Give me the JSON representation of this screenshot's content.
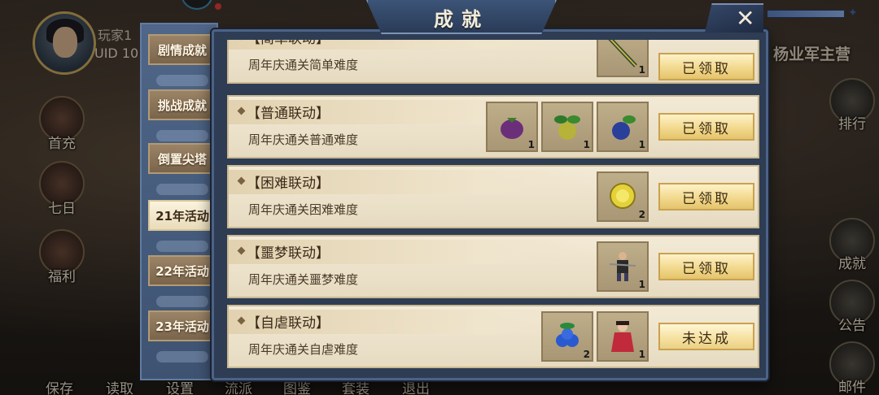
{
  "player": {
    "name": "玩家1",
    "uid": "UID 10"
  },
  "camp_title": "杨业军主营",
  "left_menu": [
    {
      "label": "首充"
    },
    {
      "label": "七日"
    },
    {
      "label": "福利"
    }
  ],
  "right_menu": [
    {
      "label": "排行"
    },
    {
      "label": "成就"
    },
    {
      "label": "公告"
    },
    {
      "label": "邮件"
    }
  ],
  "bottom_menu": [
    {
      "label": "保存"
    },
    {
      "label": "读取"
    },
    {
      "label": "设置"
    },
    {
      "label": "流派"
    },
    {
      "label": "图鉴"
    },
    {
      "label": "套装"
    },
    {
      "label": "退出"
    }
  ],
  "dialog": {
    "title": "成就",
    "close_icon": "close-x"
  },
  "tabs": [
    {
      "label": "剧情成就",
      "active": false
    },
    {
      "label": "挑战成就",
      "active": false
    },
    {
      "label": "倒置尖塔",
      "active": false
    },
    {
      "label": "21年活动",
      "active": true
    },
    {
      "label": "22年活动",
      "active": false
    },
    {
      "label": "23年活动",
      "active": false
    }
  ],
  "achievements": [
    {
      "title": "【简单联动】",
      "desc": "周年庆通关简单难度",
      "rewards": [
        {
          "icon": "spear-icon",
          "count": "1"
        }
      ],
      "button": "已领取"
    },
    {
      "title": "【普通联动】",
      "desc": "周年庆通关普通难度",
      "rewards": [
        {
          "icon": "purple-fruit-icon",
          "count": "1"
        },
        {
          "icon": "green-fruit-icon",
          "count": "1"
        },
        {
          "icon": "blue-fruit-icon",
          "count": "1"
        }
      ],
      "button": "已领取"
    },
    {
      "title": "【困难联动】",
      "desc": "周年庆通关困难难度",
      "rewards": [
        {
          "icon": "gold-coin-icon",
          "count": "2"
        }
      ],
      "button": "已领取"
    },
    {
      "title": "【噩梦联动】",
      "desc": "周年庆通关噩梦难度",
      "rewards": [
        {
          "icon": "warrior-icon",
          "count": "1"
        }
      ],
      "button": "已领取"
    },
    {
      "title": "【自虐联动】",
      "desc": "周年庆通关自虐难度",
      "rewards": [
        {
          "icon": "blue-berries-icon",
          "count": "2"
        },
        {
          "icon": "lady-character-icon",
          "count": "1"
        }
      ],
      "button": "未达成"
    }
  ]
}
